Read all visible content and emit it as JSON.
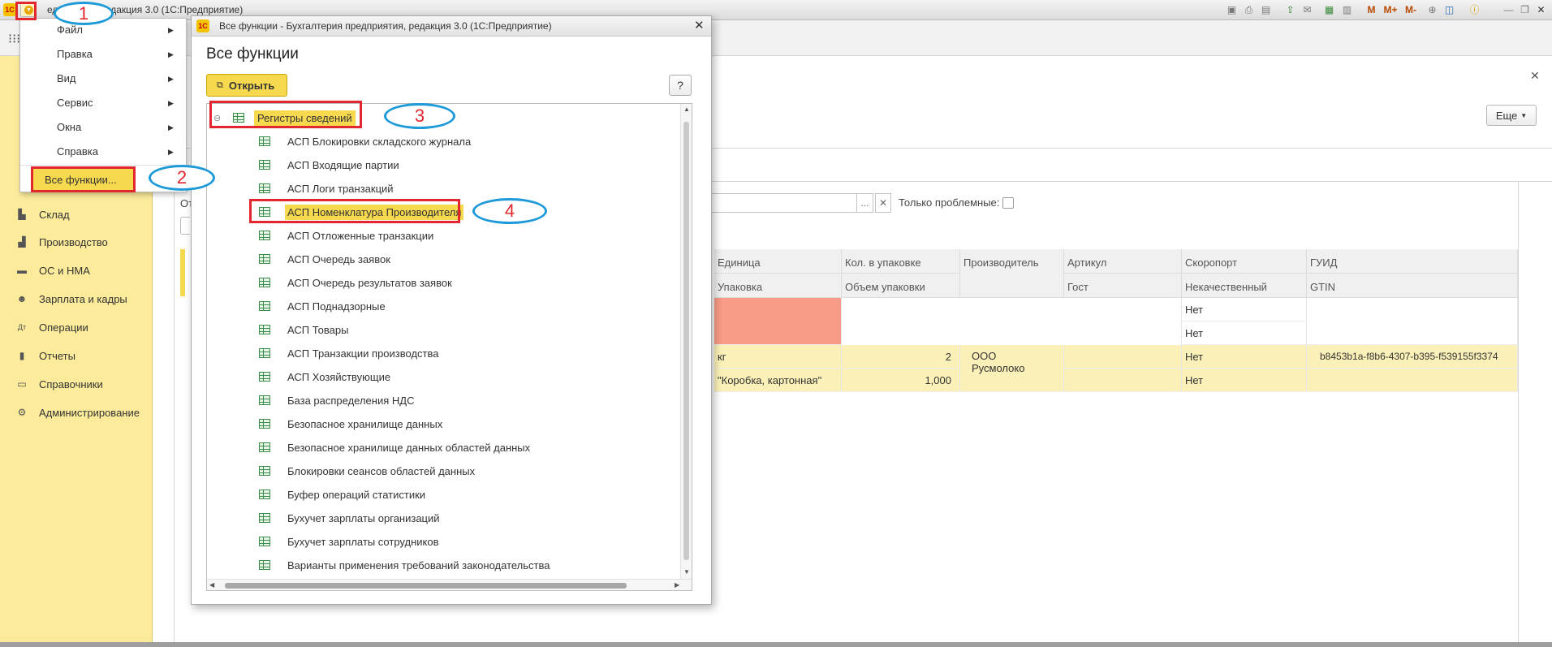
{
  "window": {
    "title": "Бухгалтерия предприятия, редакция 3.0  (1С:Предприятие)",
    "logo": "1С",
    "title_visible": "едприятия, редакция 3.0  (1С:Предприятие)",
    "toolbar_icons": [
      "save-icon",
      "print-icon",
      "preview-icon",
      "attach-icon",
      "mail-icon",
      "table-icon",
      "calendar-icon",
      "M",
      "M+",
      "M-",
      "zoom-icon",
      "panels-icon",
      "info-icon",
      "minimize-icon",
      "restore-icon",
      "close-icon"
    ]
  },
  "sidebar": {
    "items": [
      {
        "label": "Склад",
        "icon": "warehouse-icon"
      },
      {
        "label": "Производство",
        "icon": "factory-icon"
      },
      {
        "label": "ОС и НМА",
        "icon": "truck-icon"
      },
      {
        "label": "Зарплата и кадры",
        "icon": "people-icon"
      },
      {
        "label": "Операции",
        "icon": "operations-icon"
      },
      {
        "label": "Отчеты",
        "icon": "chart-icon"
      },
      {
        "label": "Справочники",
        "icon": "book-icon"
      },
      {
        "label": "Администрирование",
        "icon": "gear-icon"
      }
    ]
  },
  "main_menu": {
    "items": [
      "Файл",
      "Правка",
      "Вид",
      "Сервис",
      "Окна",
      "Справка"
    ],
    "all_functions": "Все функции..."
  },
  "main_form": {
    "more_button": "Еще",
    "filter_label_fragment": "От",
    "only_problem_label": "Только проблемные:",
    "grid": {
      "header_row1": [
        "Единица",
        "Кол. в упаковке",
        "Производитель",
        "Артикул",
        "Скоропорт",
        "ГУИД"
      ],
      "header_row2": [
        "Упаковка",
        "Объем упаковки",
        "",
        "Гост",
        "Некачественный",
        "GTIN"
      ],
      "rows": [
        {
          "unit": "",
          "qty": "",
          "maker": "",
          "article": "",
          "perishable": "Нет",
          "guid": ""
        },
        {
          "unit": "",
          "qty": "",
          "maker": "",
          "article": "",
          "perishable": "Нет",
          "guid": ""
        },
        {
          "unit": "кг",
          "qty": "2",
          "maker": "ООО Русмолоко",
          "article": "",
          "perishable": "Нет",
          "guid": "b8453b1a-f8b6-4307-b395-f539155f3374"
        },
        {
          "unit": "\"Коробка, картонная\"",
          "qty": "1,000",
          "maker": "",
          "article": "",
          "perishable": "Нет",
          "guid": ""
        }
      ]
    }
  },
  "dialog": {
    "title": "Все функции - Бухгалтерия предприятия, редакция 3.0  (1С:Предприятие)",
    "heading": "Все функции",
    "open_button": "Открыть",
    "help_button": "?",
    "root": "Регистры сведений",
    "items": [
      "АСП Блокировки складского журнала",
      "АСП Входящие партии",
      "АСП Логи транзакций",
      "АСП Номенклатура Производителя",
      "АСП Отложенные транзакции",
      "АСП Очередь заявок",
      "АСП Очередь результатов заявок",
      "АСП Поднадзорные",
      "АСП Товары",
      "АСП Транзакции производства",
      "АСП Хозяйствующие",
      "База распределения НДС",
      "Безопасное хранилище данных",
      "Безопасное хранилище данных областей данных",
      "Блокировки сеансов областей данных",
      "Буфер операций статистики",
      "Бухучет зарплаты организаций",
      "Бухучет зарплаты сотрудников",
      "Варианты применения требований законодательства"
    ],
    "selected_index": 3
  },
  "annotations": {
    "step1": "1",
    "step2": "2",
    "step3": "3",
    "step4": "4",
    "box_color": "#e0282e",
    "ellipse_color": "#1e9ad8"
  },
  "colors": {
    "accent_yellow": "#f7d94f",
    "sidebar_bg": "#fbeb9b",
    "error_cell": "#f89c88"
  }
}
